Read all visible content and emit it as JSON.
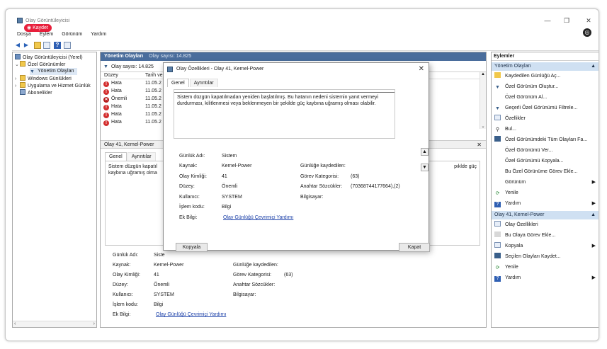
{
  "window": {
    "title": "Olay Görüntüleyicisi",
    "save_badge": "Kaydet"
  },
  "menu": [
    "Dosya",
    "Eylem",
    "Görünüm",
    "Yardım"
  ],
  "tree": {
    "root": "Olay Görüntüleyicisi (Yerel)",
    "custom_views": "Özel Görünümler",
    "admin_events": "Yönetim Olayları",
    "windows_logs": "Windows Günlükleri",
    "app_service_logs": "Uygulama ve Hizmet Günlük",
    "subscriptions": "Abonelikler"
  },
  "center": {
    "header": "Yönetim Olayları",
    "header_count": "Olay sayısı: 14.825",
    "filter": "Olay sayısı: 14.825",
    "columns": {
      "level": "Düzey",
      "date": "Tarih ve"
    },
    "rows": [
      {
        "level": "Hata",
        "date": "11.05.2",
        "kind": "error"
      },
      {
        "level": "Hata",
        "date": "11.05.2",
        "kind": "error"
      },
      {
        "level": "Önemli",
        "date": "11.05.2",
        "kind": "critical"
      },
      {
        "level": "Hata",
        "date": "11.05.2",
        "kind": "error"
      },
      {
        "level": "Hata",
        "date": "11.05.2",
        "kind": "error"
      },
      {
        "level": "Hata",
        "date": "11.05.2",
        "kind": "error"
      }
    ],
    "detail_title": "Olay 41, Kernel-Power",
    "tabs": [
      "Genel",
      "Ayrıntılar"
    ],
    "message_start": "Sistem düzgün kapatıl",
    "message_line2": "kaybına uğramış olma",
    "message_tail": "pıklde güç",
    "fields": {
      "log_name_label": "Günlük Adı:",
      "log_name_value": "Siste",
      "source_label": "Kaynak:",
      "source_value": "Kernel-Power",
      "event_id_label": "Olay Kimliği:",
      "event_id_value": "41",
      "level_label": "Düzey:",
      "level_value": "Önemli",
      "user_label": "Kullanıcı:",
      "user_value": "SYSTEM",
      "opcode_label": "İşlem kodu:",
      "opcode_value": "Bilgi",
      "more_info_label": "Ek Bilgi:",
      "more_info_link": "Olay Günlüğü Çevrimiçi Yardımı",
      "logged_label": "Günlüğe kaydedilen:",
      "task_label": "Görev Kategorisi:",
      "task_value": "(63)",
      "keywords_label": "Anahtar Sözcükler:",
      "computer_label": "Bilgisayar:"
    }
  },
  "actions": {
    "title": "Eylemler",
    "section1": "Yönetim Olayları",
    "section1_items": [
      "Kaydedilen Günlüğü Aç...",
      "Özel Görünüm Oluştur...",
      "Özel Görünüm Al...",
      "Geçerli Özel Görünümü Filtrele...",
      "Özellikler",
      "Bul...",
      "Özel Görünümdeki Tüm Olayları Fa...",
      "Özel Görünümü Ver...",
      "Özel Görünümü Kopyala...",
      "Bu Özel Görünüme Görev Ekle...",
      "Görünüm",
      "Yenile",
      "Yardım"
    ],
    "section2": "Olay 41, Kernel-Power",
    "section2_items": [
      "Olay Özellikleri",
      "Bu Olaya Görev Ekle...",
      "Kopyala",
      "Seçilen Olayları Kaydet...",
      "Yenile",
      "Yardım"
    ]
  },
  "dialog": {
    "title": "Olay Özellikleri - Olay 41, Kernel-Power",
    "tabs": [
      "Genel",
      "Ayrıntılar"
    ],
    "message_line1": "Sistem düzgün kapatılmadan yeniden başlatılmış. Bu hatanın nedeni sistemin yanıt vermeyi",
    "message_line2": "durdurması, kilitlenmesi veya beklenmeyen bir şekilde güç kaybına uğramış olması olabilir.",
    "fields": {
      "log_name_label": "Günlük Adı:",
      "log_name_value": "Sistem",
      "source_label": "Kaynak:",
      "source_value": "Kernel-Power",
      "event_id_label": "Olay Kimliği:",
      "event_id_value": "41",
      "level_label": "Düzey:",
      "level_value": "Önemli",
      "user_label": "Kullanıcı:",
      "user_value": "SYSTEM",
      "opcode_label": "İşlem kodu:",
      "opcode_value": "Bilgi",
      "more_info_label": "Ek Bilgi:",
      "more_info_link": "Olay Günlüğü Çevrimiçi Yardımı",
      "logged_label": "Günlüğe kaydedilen:",
      "task_label": "Görev Kategorisi:",
      "task_value": "(63)",
      "keywords_label": "Anahtar Sözcükler:",
      "keywords_value": "(70368744177664),(2)",
      "computer_label": "Bilgisayar:"
    },
    "copy_button": "Kopyala",
    "close_button": "Kapat"
  }
}
